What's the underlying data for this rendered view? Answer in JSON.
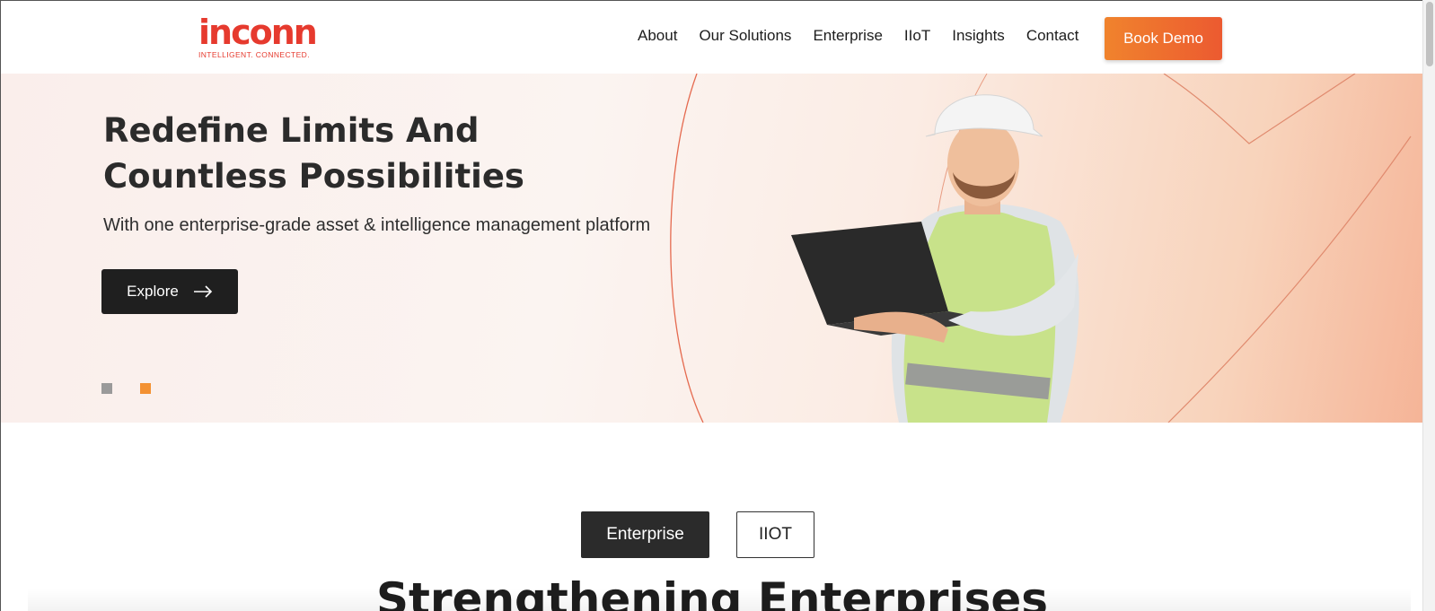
{
  "header": {
    "logo": {
      "wordmark": "inconn",
      "tagline": "INTELLIGENT. CONNECTED."
    },
    "nav": [
      "About",
      "Our Solutions",
      "Enterprise",
      "IIoT",
      "Insights",
      "Contact"
    ],
    "cta": "Book Demo"
  },
  "hero": {
    "title_line1": "Redefine Limits And",
    "title_line2": "Countless Possibilities",
    "subtitle": "With one enterprise-grade asset & intelligence management platform",
    "button": "Explore",
    "slide_count": 2,
    "active_slide": 2
  },
  "tabs": {
    "active": "Enterprise",
    "other": "IIOT"
  },
  "section": {
    "title": "Strengthening Enterprises"
  },
  "colors": {
    "brand_red": "#e63a2e",
    "accent_orange": "#f0832d",
    "dark": "#1f1f1f"
  }
}
